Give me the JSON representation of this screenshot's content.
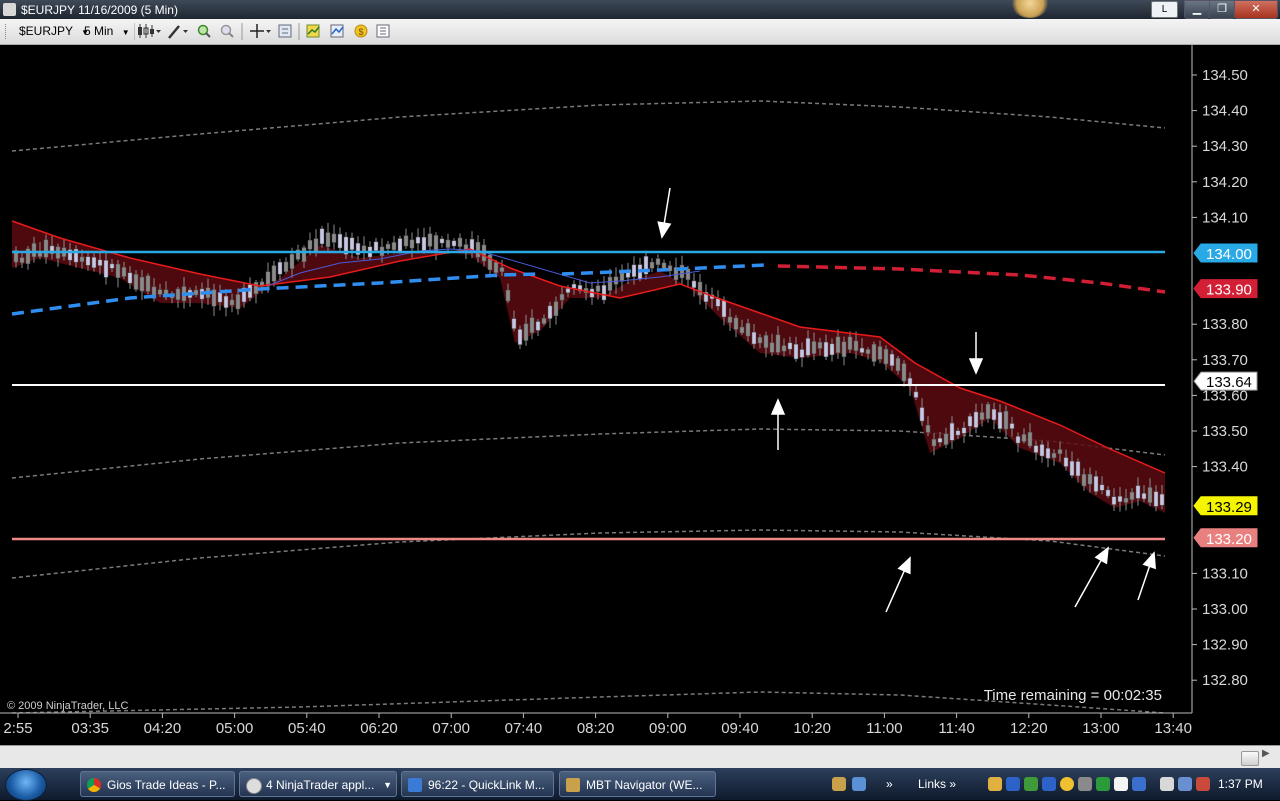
{
  "window": {
    "title": "$EURJPY  11/16/2009 (5 Min)",
    "l_button": "L"
  },
  "toolbar": {
    "instrument": "$EURJPY",
    "interval": "5 Min",
    "tools": [
      "bar-type-icon",
      "drawing-tools-icon",
      "zoom-in-icon",
      "zoom-out-icon",
      "crosshair-icon",
      "properties-icon",
      "strategies-icon",
      "indicators-icon",
      "data-box-icon",
      "chart-data-icon"
    ]
  },
  "chart": {
    "copyright": "© 2009 NinjaTrader, LLC",
    "time_remaining": "Time remaining = 00:02:35",
    "price_ticks": [
      "134.50",
      "134.40",
      "134.30",
      "134.20",
      "134.10",
      "133.80",
      "133.70",
      "133.60",
      "133.50",
      "133.40",
      "133.10",
      "133.00",
      "132.90",
      "132.80"
    ],
    "price_flags": [
      {
        "label": "134.00",
        "color": "#29a9e6",
        "text_color": "#ffffff"
      },
      {
        "label": "133.90",
        "color": "#d21f35",
        "text_color": "#ffffff"
      },
      {
        "label": "133.64",
        "color": "#ffffff",
        "text_color": "#000000"
      },
      {
        "label": "133.29",
        "color": "#f5f500",
        "text_color": "#000000"
      },
      {
        "label": "133.20",
        "color": "#e88080",
        "text_color": "#ffffff"
      }
    ],
    "time_labels": [
      "2:55",
      "03:35",
      "04:20",
      "05:00",
      "05:40",
      "06:20",
      "07:00",
      "07:40",
      "08:20",
      "09:00",
      "09:40",
      "10:20",
      "11:00",
      "11:40",
      "12:20",
      "13:00",
      "13:40"
    ],
    "colors": {
      "up_candle": "#c7c7e3",
      "down_candle": "#8a8a8a",
      "down_fill": "#5c0a10",
      "ema": "#e81b1b",
      "band": "#7a7a7a"
    }
  },
  "taskbar": {
    "items": [
      {
        "label": "Gios Trade Ideas - P...",
        "icon": "chrome-icon"
      },
      {
        "label": "4 NinjaTrader appl...",
        "icon": "ninjatrader-icon"
      },
      {
        "label": "96:22 - QuickLink M...",
        "icon": "quicklink-icon"
      },
      {
        "label": "MBT Navigator (WE...",
        "icon": "mbt-icon"
      }
    ],
    "links_label": "Links",
    "clock": "1:37 PM"
  }
}
